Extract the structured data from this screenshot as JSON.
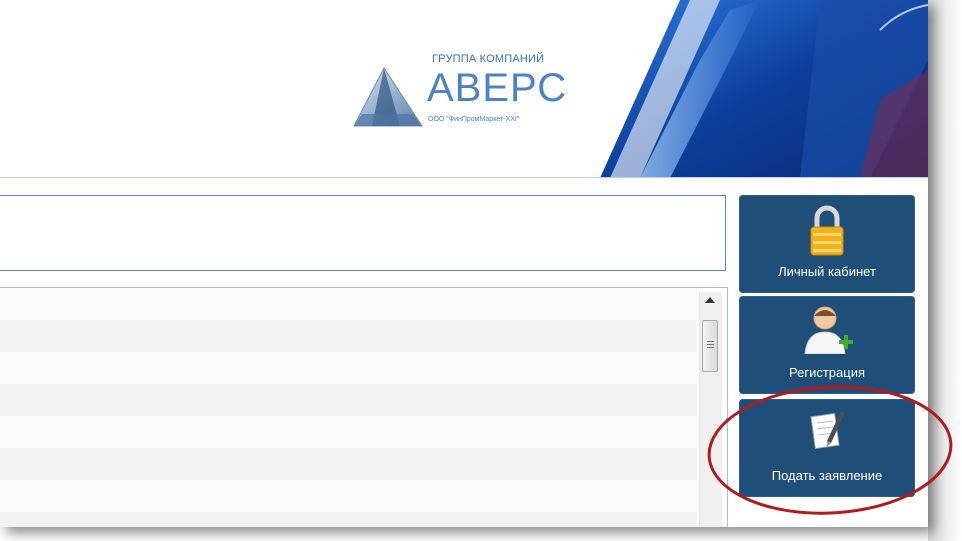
{
  "header": {
    "logo": {
      "group_label": "ГРУППА КОМПАНИЙ",
      "name": "АВЕРС",
      "subtitle": "ООО \"ФинПромМаркет-XXI\""
    }
  },
  "side_buttons": [
    {
      "label": "Личный кабинет",
      "icon": "lock-icon"
    },
    {
      "label": "Регистрация",
      "icon": "add-user-icon"
    },
    {
      "label": "Подать заявление",
      "icon": "document-pen-icon"
    }
  ],
  "colors": {
    "button_bg": "#1f4e79",
    "annotation": "#b01c1c",
    "border": "#5e86b8"
  }
}
